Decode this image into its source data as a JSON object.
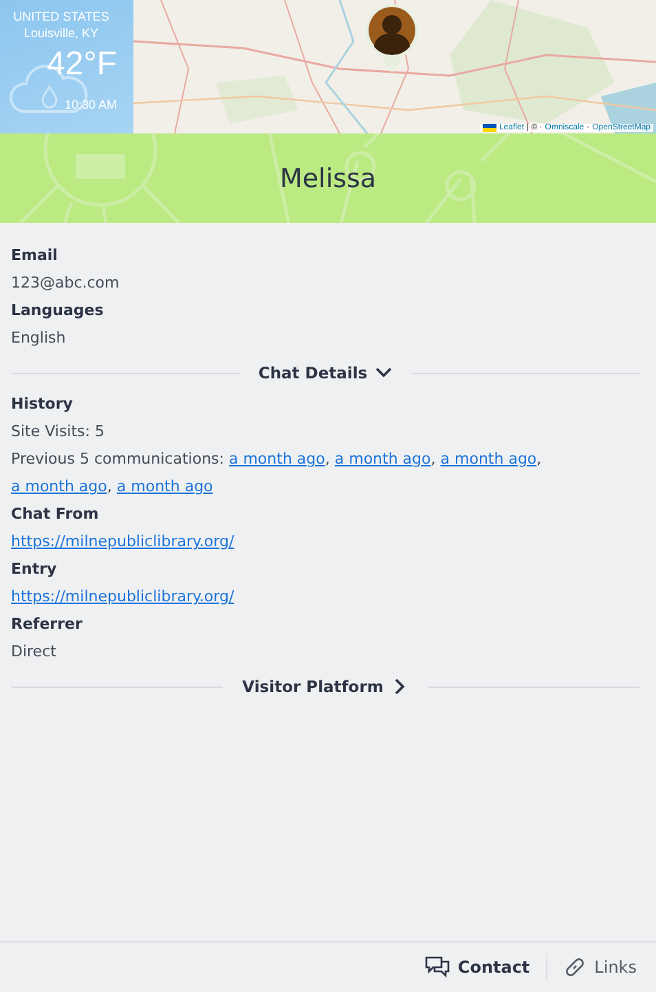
{
  "weather": {
    "country": "UNITED STATES",
    "city": "Louisville, KY",
    "temperature": "42°F",
    "time": "10:30 AM"
  },
  "map": {
    "kind": "picture",
    "attribution": [
      {
        "text": "Leaflet",
        "link": true
      },
      {
        "text": "| © ·",
        "link": false
      },
      {
        "text": "Omniscale",
        "link": true
      },
      {
        "text": "·",
        "link": false
      },
      {
        "text": "OpenStreetMap",
        "link": true
      }
    ]
  },
  "visitor": {
    "name": "Melissa"
  },
  "fields": [
    {
      "label": "Email",
      "value": "123@abc.com"
    },
    {
      "label": "Languages",
      "value": "English"
    }
  ],
  "sections": [
    {
      "title": "Chat Details",
      "expanded": true,
      "history": {
        "label": "History",
        "site_visits": "Site Visits: 5",
        "previous": "Previous 5 communications:",
        "links": [
          {
            "text": "a month ago",
            "separator": ","
          },
          {
            "text": "a month ago",
            "separator": ","
          },
          {
            "text": "a month ago",
            "separator": ","
          },
          {
            "text": "a month ago",
            "separator": ","
          },
          {
            "text": "a month ago"
          }
        ]
      },
      "fields": [
        {
          "label": "Chat From",
          "value": "https://milnepubliclibrary.org/",
          "link": true
        },
        {
          "label": "Entry",
          "value": "https://milnepubliclibrary.org/",
          "link": true
        },
        {
          "label": "Referrer",
          "value": "Direct",
          "link": false
        }
      ]
    },
    {
      "title": "Visitor Platform",
      "expanded": false
    }
  ],
  "footer_tabs": [
    {
      "label": "Contact",
      "kind": "contact",
      "selected": true
    },
    {
      "label": "Links",
      "kind": "links",
      "selected": false
    }
  ]
}
